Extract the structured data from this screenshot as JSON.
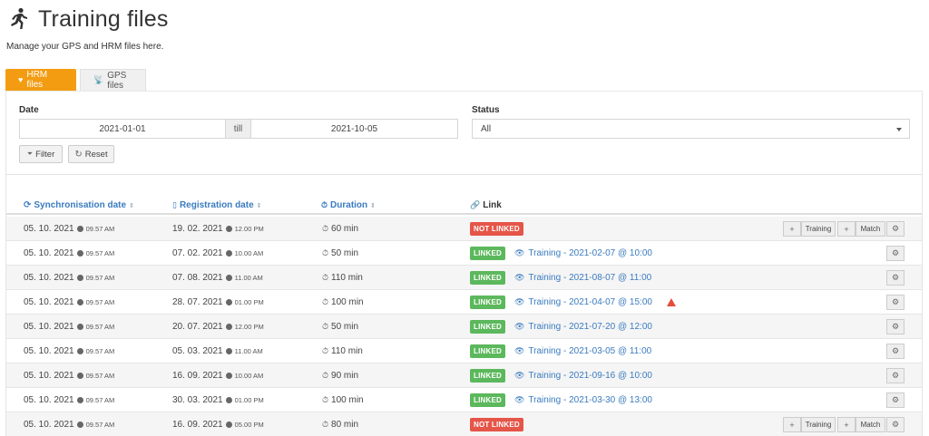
{
  "page": {
    "title": "Training files",
    "subtitle": "Manage your GPS and HRM files here."
  },
  "tabs": [
    {
      "label": "HRM files",
      "icon": "heart-icon",
      "active": true
    },
    {
      "label": "GPS files",
      "icon": "satellite-icon",
      "active": false
    }
  ],
  "filters": {
    "date_label": "Date",
    "date_from": "2021-01-01",
    "till_label": "till",
    "date_to": "2021-10-05",
    "status_label": "Status",
    "status_value": "All",
    "filter_button": "Filter",
    "reset_button": "Reset"
  },
  "table": {
    "columns": {
      "sync": "Synchronisation date",
      "registration": "Registration date",
      "duration": "Duration",
      "link": "Link"
    },
    "rows": [
      {
        "sync_date": "05. 10. 2021",
        "sync_time": "09.57 AM",
        "reg_date": "19. 02. 2021",
        "reg_time": "12.00 PM",
        "duration": "60 min",
        "status": "NOT LINKED",
        "training": "",
        "warning": false
      },
      {
        "sync_date": "05. 10. 2021",
        "sync_time": "09.57 AM",
        "reg_date": "07. 02. 2021",
        "reg_time": "10.00 AM",
        "duration": "50 min",
        "status": "LINKED",
        "training": "Training - 2021-02-07 @ 10:00",
        "warning": false
      },
      {
        "sync_date": "05. 10. 2021",
        "sync_time": "09.57 AM",
        "reg_date": "07. 08. 2021",
        "reg_time": "11.00 AM",
        "duration": "110 min",
        "status": "LINKED",
        "training": "Training - 2021-08-07 @ 11:00",
        "warning": false
      },
      {
        "sync_date": "05. 10. 2021",
        "sync_time": "09.57 AM",
        "reg_date": "28. 07. 2021",
        "reg_time": "01.00 PM",
        "duration": "100 min",
        "status": "LINKED",
        "training": "Training - 2021-04-07 @ 15:00",
        "warning": true
      },
      {
        "sync_date": "05. 10. 2021",
        "sync_time": "09.57 AM",
        "reg_date": "20. 07. 2021",
        "reg_time": "12.00 PM",
        "duration": "50 min",
        "status": "LINKED",
        "training": "Training - 2021-07-20 @ 12:00",
        "warning": false
      },
      {
        "sync_date": "05. 10. 2021",
        "sync_time": "09.57 AM",
        "reg_date": "05. 03. 2021",
        "reg_time": "11.00 AM",
        "duration": "110 min",
        "status": "LINKED",
        "training": "Training - 2021-03-05 @ 11:00",
        "warning": false
      },
      {
        "sync_date": "05. 10. 2021",
        "sync_time": "09.57 AM",
        "reg_date": "16. 09. 2021",
        "reg_time": "10.00 AM",
        "duration": "90 min",
        "status": "LINKED",
        "training": "Training - 2021-09-16 @ 10:00",
        "warning": false
      },
      {
        "sync_date": "05. 10. 2021",
        "sync_time": "09.57 AM",
        "reg_date": "30. 03. 2021",
        "reg_time": "01.00 PM",
        "duration": "100 min",
        "status": "LINKED",
        "training": "Training - 2021-03-30 @ 13:00",
        "warning": false
      },
      {
        "sync_date": "05. 10. 2021",
        "sync_time": "09.57 AM",
        "reg_date": "16. 09. 2021",
        "reg_time": "05.00 PM",
        "duration": "80 min",
        "status": "NOT LINKED",
        "training": "",
        "warning": false
      }
    ],
    "actions": {
      "plus": "+",
      "training": "Training",
      "match": "Match",
      "gear": "⚙"
    }
  },
  "colors": {
    "accent": "#f39c12",
    "link": "#3a7bbf",
    "linked": "#5cb85c",
    "not_linked": "#e55548"
  }
}
